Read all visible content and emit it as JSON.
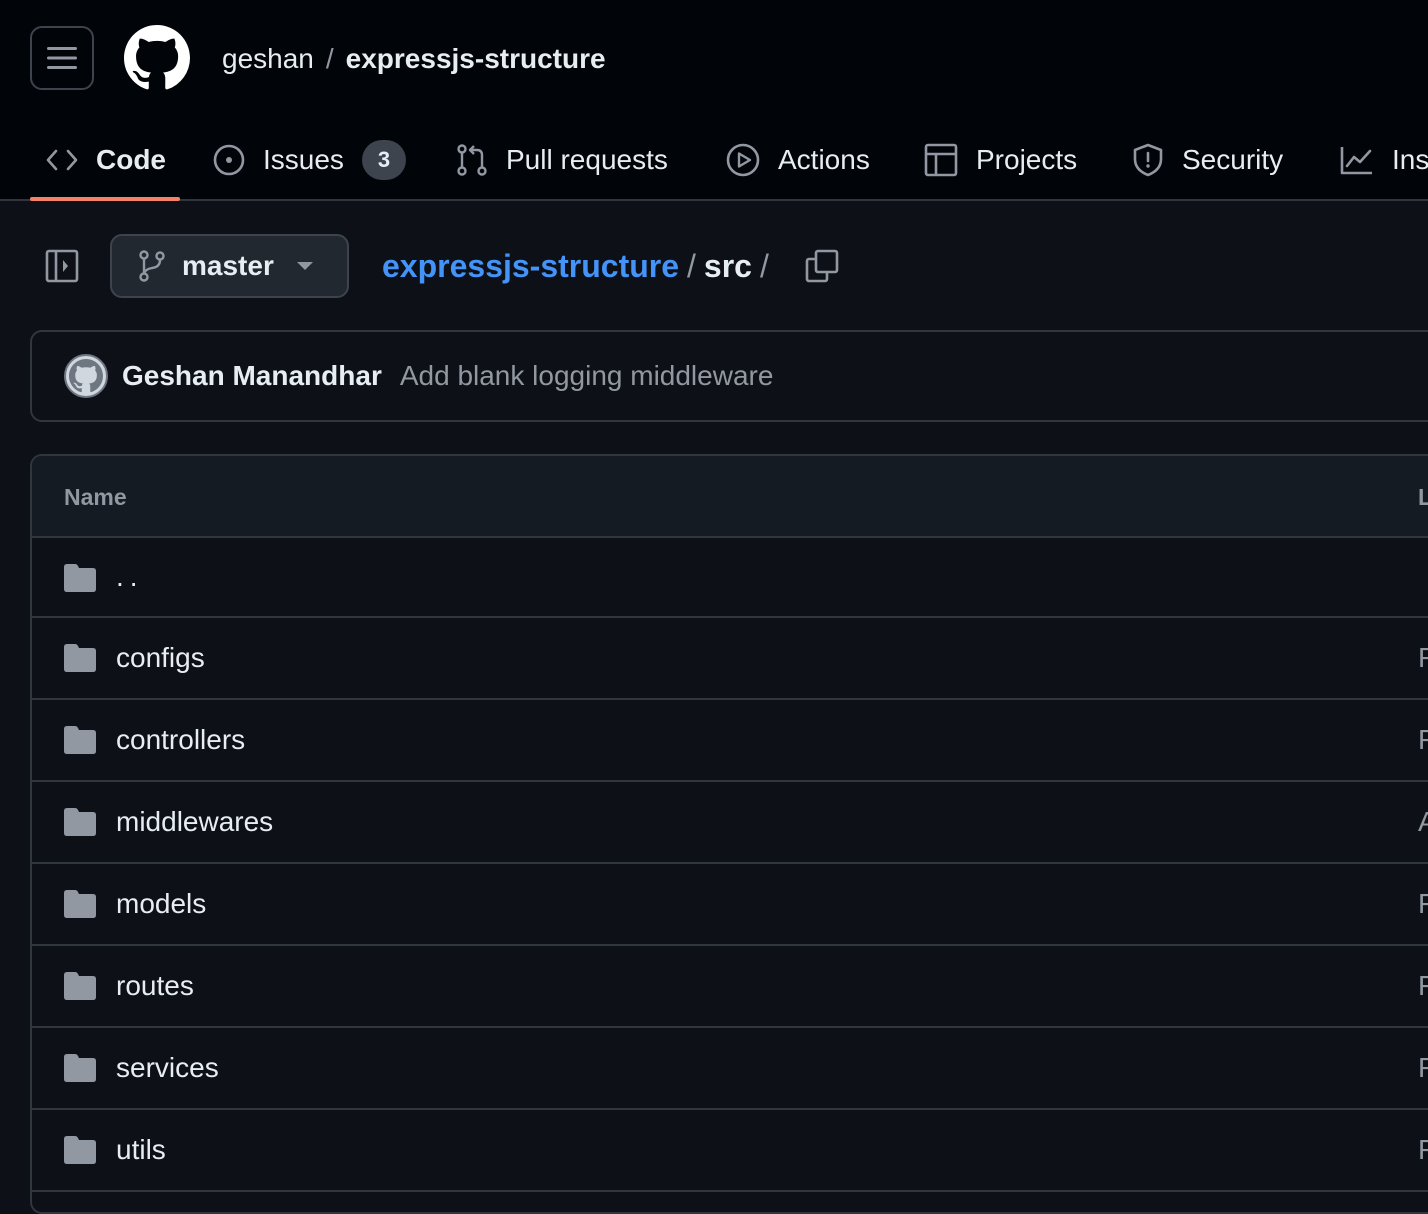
{
  "header": {
    "owner": "geshan",
    "separator": "/",
    "repo": "expressjs-structure"
  },
  "tabs": [
    {
      "label": "Code",
      "icon": "code-icon",
      "active": true
    },
    {
      "label": "Issues",
      "icon": "issue-opened-icon",
      "counter": "3"
    },
    {
      "label": "Pull requests",
      "icon": "git-pull-request-icon"
    },
    {
      "label": "Actions",
      "icon": "play-icon"
    },
    {
      "label": "Projects",
      "icon": "table-icon"
    },
    {
      "label": "Security",
      "icon": "shield-icon"
    },
    {
      "label": "Ins",
      "icon": "graph-icon"
    }
  ],
  "toolbar": {
    "branch": "master",
    "breadcrumb_repo": "expressjs-structure",
    "breadcrumb_sep": "/",
    "breadcrumb_dir": "src",
    "breadcrumb_trailing": "/"
  },
  "commit": {
    "author": "Geshan Manandhar",
    "message": "Add blank logging middleware"
  },
  "table": {
    "header_name": "Name",
    "header_last": "L",
    "rows": [
      {
        "name": "..",
        "last": ""
      },
      {
        "name": "configs",
        "last": "F"
      },
      {
        "name": "controllers",
        "last": "F"
      },
      {
        "name": "middlewares",
        "last": "A"
      },
      {
        "name": "models",
        "last": "F"
      },
      {
        "name": "routes",
        "last": "F"
      },
      {
        "name": "services",
        "last": "F"
      },
      {
        "name": "utils",
        "last": "F"
      }
    ]
  },
  "colors": {
    "background": "#0d1117",
    "header_background": "#010409",
    "link": "#4493f8",
    "active_tab_underline": "#f78166",
    "border": "#30363d",
    "muted": "#9198a1",
    "folder": "#9198a1"
  }
}
